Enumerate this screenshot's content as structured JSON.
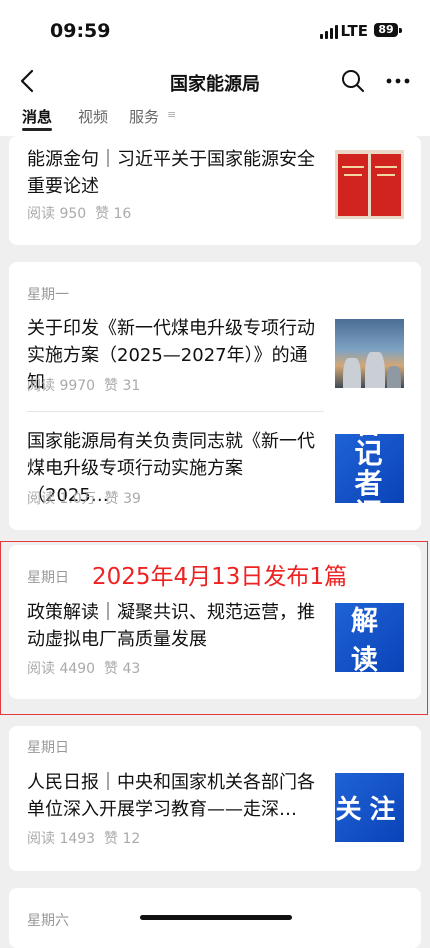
{
  "status_bar": {
    "time": "09:59",
    "network": "LTE",
    "battery": "89"
  },
  "nav": {
    "title": "国家能源局"
  },
  "tabs": [
    {
      "label": "消息",
      "active": true
    },
    {
      "label": "视频",
      "active": false
    },
    {
      "label": "服务",
      "active": false
    }
  ],
  "cards": [
    {
      "articles": [
        {
          "title": "能源金句｜习近平关于国家能源安全重要论述",
          "reads": "阅读 950",
          "likes": "赞 16"
        }
      ]
    },
    {
      "day": "星期一",
      "articles": [
        {
          "title": "关于印发《新一代煤电升级专项行动实施方案（2025—2027年）》的通知",
          "reads": "阅读 9970",
          "likes": "赞 31"
        },
        {
          "title": "国家能源局有关负责同志就《新一代煤电升级专项行动实施方案（2025…",
          "reads": "阅读 1.0万",
          "likes": "赞 39",
          "thumb_text": "答记者问"
        }
      ]
    },
    {
      "day": "星期日",
      "articles": [
        {
          "title": "政策解读｜凝聚共识、规范运营，推动虚拟电厂高质量发展",
          "reads": "阅读 4490",
          "likes": "赞 43",
          "thumb_text": "解读"
        }
      ]
    },
    {
      "day": "星期日",
      "articles": [
        {
          "title": "人民日报｜中央和国家机关各部门各单位深入开展学习教育——走深…",
          "reads": "阅读 1493",
          "likes": "赞 12",
          "thumb_text": "关注"
        }
      ]
    },
    {
      "day": "星期六"
    }
  ],
  "annotation": "2025年4月13日发布1篇",
  "colors": {
    "annotation": "#ee2222",
    "thumb_blue": "#1456cc",
    "background": "#efefef"
  }
}
